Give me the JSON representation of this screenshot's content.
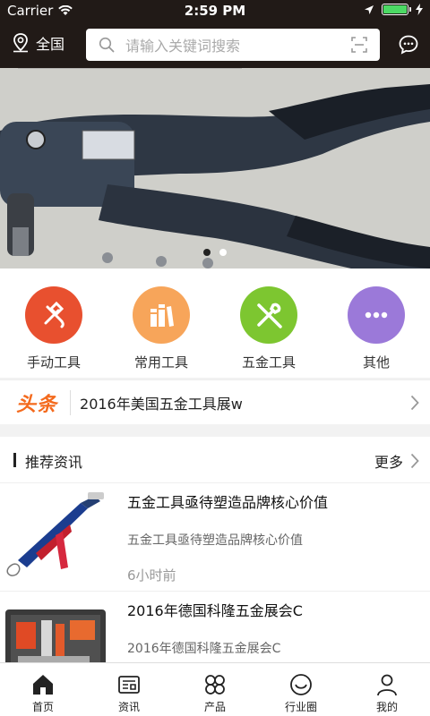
{
  "status_bar": {
    "carrier": "Carrier",
    "time": "2:59 PM",
    "battery_level": 1.0
  },
  "header": {
    "region": "全国",
    "search_placeholder": "请输入关键词搜索"
  },
  "banner": {
    "pages": 2,
    "active_page": 1
  },
  "categories": [
    {
      "label": "手动工具",
      "color": "#e8502f",
      "icon": "hammer-wrench-icon"
    },
    {
      "label": "常用工具",
      "color": "#f7a55a",
      "icon": "book-stack-icon"
    },
    {
      "label": "五金工具",
      "color": "#7dc630",
      "icon": "tools-icon"
    },
    {
      "label": "其他",
      "color": "#9b79d9",
      "icon": "more-dots-icon"
    }
  ],
  "headline": {
    "tag": "头条",
    "text": "2016年美国五金工具展w"
  },
  "news_section": {
    "title": "推荐资讯",
    "more": "更多"
  },
  "news": [
    {
      "title": "五金工具亟待塑造品牌核心价值",
      "desc": "五金工具亟待塑造品牌核心价值",
      "time": "6小时前"
    },
    {
      "title": "2016年德国科隆五金展会C",
      "desc": "2016年德国科隆五金展会C",
      "time": ""
    }
  ],
  "tabs": [
    {
      "label": "首页",
      "icon": "home-icon",
      "active": true
    },
    {
      "label": "资讯",
      "icon": "news-icon",
      "active": false
    },
    {
      "label": "产品",
      "icon": "products-icon",
      "active": false
    },
    {
      "label": "行业圈",
      "icon": "circle-face-icon",
      "active": false
    },
    {
      "label": "我的",
      "icon": "user-icon",
      "active": false
    }
  ],
  "colors": {
    "header_bg": "#211a17",
    "accent": "#f46a1d"
  }
}
